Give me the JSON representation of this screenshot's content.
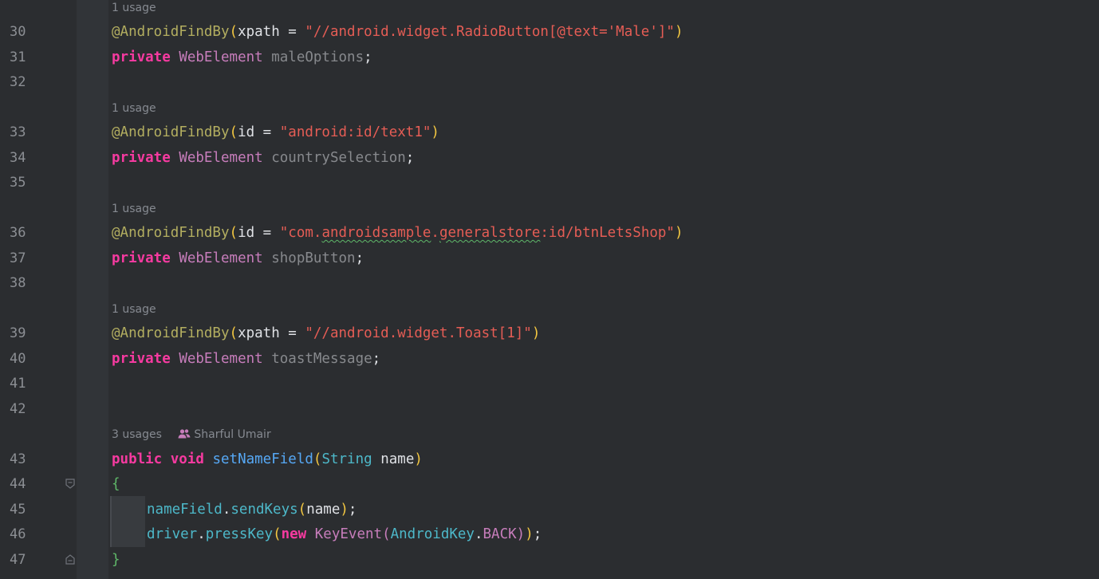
{
  "editor": {
    "lines": [
      {
        "num": "30"
      },
      {
        "num": "31"
      },
      {
        "num": "32"
      },
      {
        "num": "33"
      },
      {
        "num": "34"
      },
      {
        "num": "35"
      },
      {
        "num": "36"
      },
      {
        "num": "37"
      },
      {
        "num": "38"
      },
      {
        "num": "39"
      },
      {
        "num": "40"
      },
      {
        "num": "41"
      },
      {
        "num": "42"
      },
      {
        "num": "43"
      },
      {
        "num": "44"
      },
      {
        "num": "45"
      },
      {
        "num": "46"
      },
      {
        "num": "47"
      }
    ],
    "hints": {
      "usage1": "1 usage",
      "usage2": "1 usage",
      "usage3": "1 usage",
      "usage4": "1 usage",
      "usages_method": "3 usages",
      "author": "Sharful Umair"
    },
    "code": {
      "l30_ann": "@AndroidFindBy",
      "l30_param": "xpath",
      "l30_eq": " = ",
      "l30_str": "\"//android.widget.RadioButton[@text='Male']\"",
      "l31_kw": "private",
      "l31_type": "WebElement",
      "l31_name": "maleOptions",
      "l33_ann": "@AndroidFindBy",
      "l33_param": "id",
      "l33_str": "\"android:id/text1\"",
      "l34_kw": "private",
      "l34_type": "WebElement",
      "l34_name": "countrySelection",
      "l36_ann": "@AndroidFindBy",
      "l36_param": "id",
      "l36_str_a": "\"com.",
      "l36_str_b": "androidsample",
      "l36_str_c": ".",
      "l36_str_d": "generalstore",
      "l36_str_e": ":id/btnLetsShop\"",
      "l37_kw": "private",
      "l37_type": "WebElement",
      "l37_name": "shopButton",
      "l39_ann": "@AndroidFindBy",
      "l39_param": "xpath",
      "l39_str": "\"//android.widget.Toast[1]\"",
      "l40_kw": "private",
      "l40_type": "WebElement",
      "l40_name": "toastMessage",
      "l43_kw1": "public",
      "l43_kw2": "void",
      "l43_fn": "setNameField",
      "l43_ptype": "String",
      "l43_pname": "name",
      "l44_brace": "{",
      "l45_obj": "nameField",
      "l45_fn": "sendKeys",
      "l45_arg": "name",
      "l46_obj": "driver",
      "l46_fn": "pressKey",
      "l46_new": "new",
      "l46_cls": "KeyEvent",
      "l46_enum": "AndroidKey",
      "l46_const": "BACK",
      "l47_brace": "}"
    },
    "colors": {
      "background": "#2b2d30",
      "keyword": "#f63aa0",
      "annotation": "#b3ae60",
      "string": "#e55d55",
      "type": "#c77dbb",
      "function": "#56a8f5"
    }
  }
}
